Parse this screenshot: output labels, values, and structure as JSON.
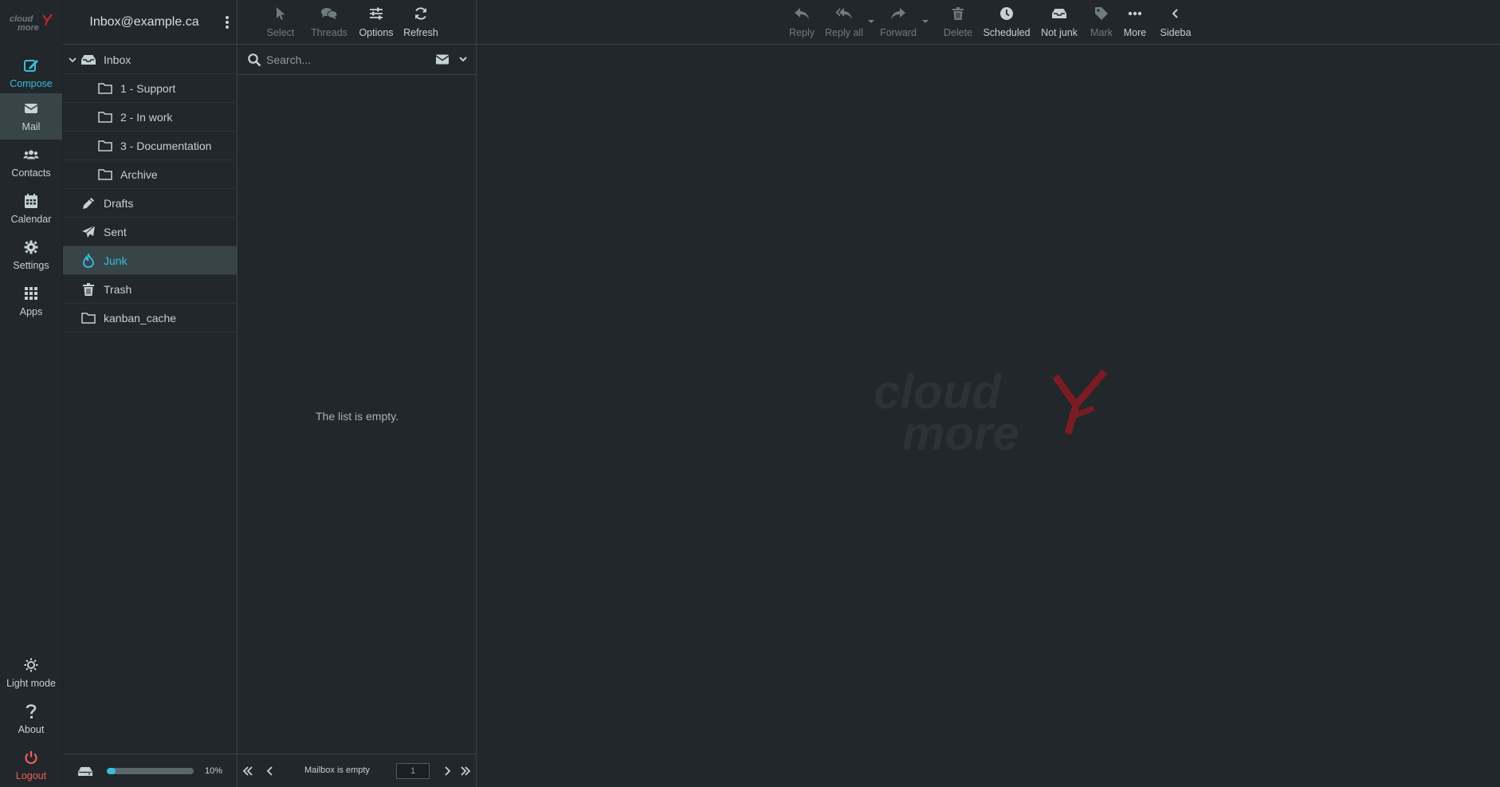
{
  "colors": {
    "background": "#21272b",
    "panel_border": "#374549",
    "accent": "#37beda",
    "danger": "#f25a5a",
    "selected_bg": "#374549",
    "disabled_text": "#6f7c80",
    "watermark_red": "#7a1c22",
    "watermark_text": "#2c3338"
  },
  "rail": {
    "logo_icon": "cloudmore-logo",
    "compose": {
      "label": "Compose",
      "icon": "compose-icon"
    },
    "mail": {
      "label": "Mail",
      "icon": "envelope-icon"
    },
    "contacts": {
      "label": "Contacts",
      "icon": "users-icon"
    },
    "calendar": {
      "label": "Calendar",
      "icon": "calendar-icon"
    },
    "settings": {
      "label": "Settings",
      "icon": "gear-icon"
    },
    "apps": {
      "label": "Apps",
      "icon": "grid-icon"
    },
    "light_mode": {
      "label": "Light mode",
      "icon": "sun-icon"
    },
    "about": {
      "label": "About",
      "icon": "question-icon"
    },
    "logout": {
      "label": "Logout",
      "icon": "power-icon"
    }
  },
  "folders": {
    "account": "Inbox@example.ca",
    "items": [
      {
        "label": "Inbox",
        "icon": "inbox-icon",
        "expanded": true
      },
      {
        "label": "1 - Support",
        "icon": "folder-icon"
      },
      {
        "label": "2 - In work",
        "icon": "folder-icon"
      },
      {
        "label": "3 - Documentation",
        "icon": "folder-icon"
      },
      {
        "label": "Archive",
        "icon": "folder-icon"
      },
      {
        "label": "Drafts",
        "icon": "pencil-icon"
      },
      {
        "label": "Sent",
        "icon": "paper-plane-icon"
      },
      {
        "label": "Junk",
        "icon": "fire-icon",
        "selected": true
      },
      {
        "label": "Trash",
        "icon": "trash-icon"
      },
      {
        "label": "kanban_cache",
        "icon": "folder-icon"
      }
    ],
    "quota": {
      "percent": 10,
      "label": "10%"
    }
  },
  "list": {
    "toolbar": {
      "select": "Select",
      "threads": "Threads",
      "options": "Options",
      "refresh": "Refresh"
    },
    "search_placeholder": "Search...",
    "empty_text": "The list is empty.",
    "pager": {
      "status": "Mailbox is empty",
      "page": "1"
    }
  },
  "main_toolbar": {
    "reply": "Reply",
    "reply_all": "Reply all",
    "forward": "Forward",
    "delete": "Delete",
    "scheduled": "Scheduled",
    "not_junk": "Not junk",
    "mark": "Mark",
    "more": "More",
    "sidebar": "Sideba"
  },
  "watermark": {
    "line1": "cloud",
    "line2": "more"
  }
}
